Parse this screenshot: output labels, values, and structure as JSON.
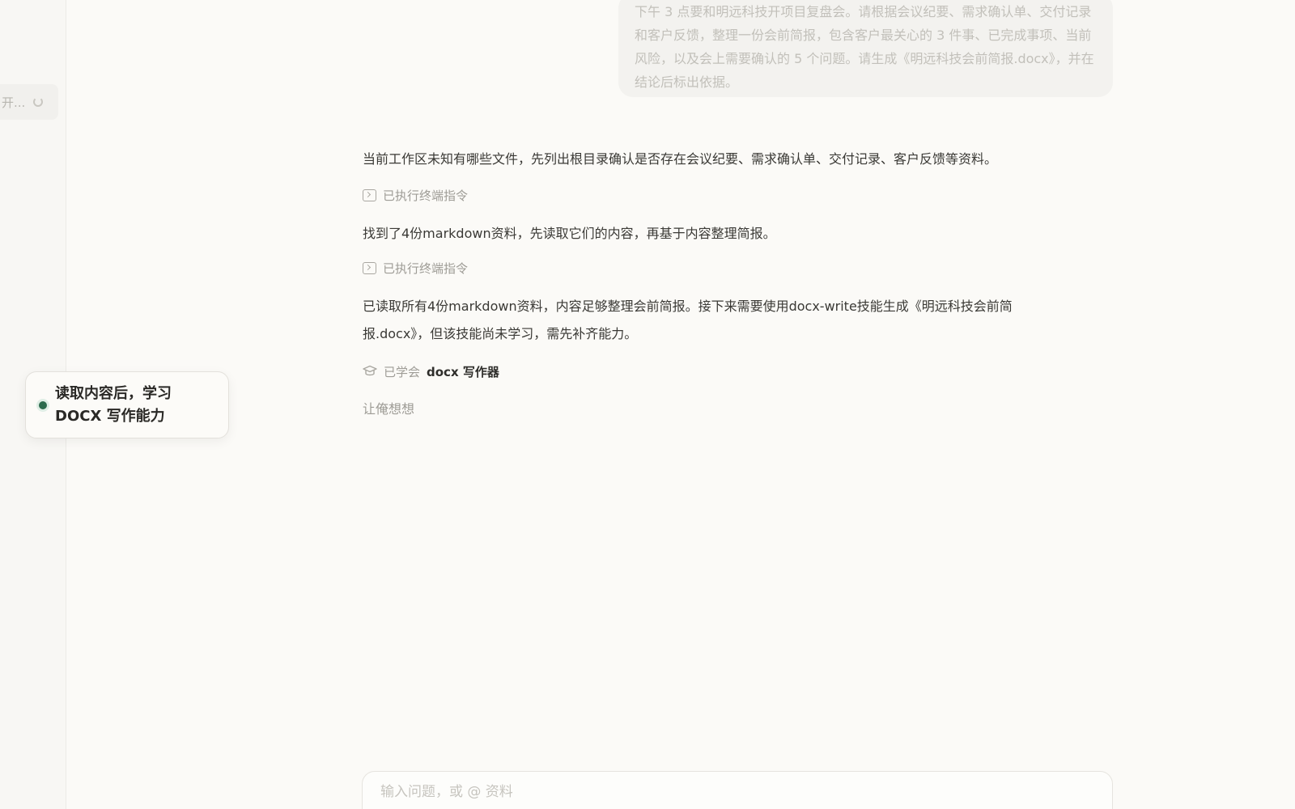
{
  "sidebar": {
    "session_label": "开..."
  },
  "hint_card": {
    "text": "读取内容后，学习\nDOCX 写作能力"
  },
  "user_message": {
    "text": "下午 3 点要和明远科技开项目复盘会。请根据会议纪要、需求确认单、交付记录和客户反馈，整理一份会前简报，包含客户最关心的 3 件事、已完成事项、当前风险，以及会上需要确认的 5 个问题。请生成《明远科技会前简报.docx》，并在结论后标出依据。"
  },
  "assistant": {
    "msg1": "当前工作区未知有哪些文件，先列出根目录确认是否存在会议纪要、需求确认单、交付记录、客户反馈等资料。",
    "tool1": "已执行终端指令",
    "msg2": "找到了4份markdown资料，先读取它们的内容，再基于内容整理简报。",
    "tool2": "已执行终端指令",
    "msg3": "已读取所有4份markdown资料，内容足够整理会前简报。接下来需要使用docx-write技能生成《明远科技会前简报.docx》，但该技能尚未学习，需先补齐能力。",
    "skill_prefix": "已学会",
    "skill_name": "docx 写作器",
    "thinking": "让俺想想"
  },
  "input": {
    "placeholder": "输入问题，或 @ 资料"
  },
  "colors": {
    "accent_green": "#2c6a4c",
    "background": "#fbfaf7"
  }
}
